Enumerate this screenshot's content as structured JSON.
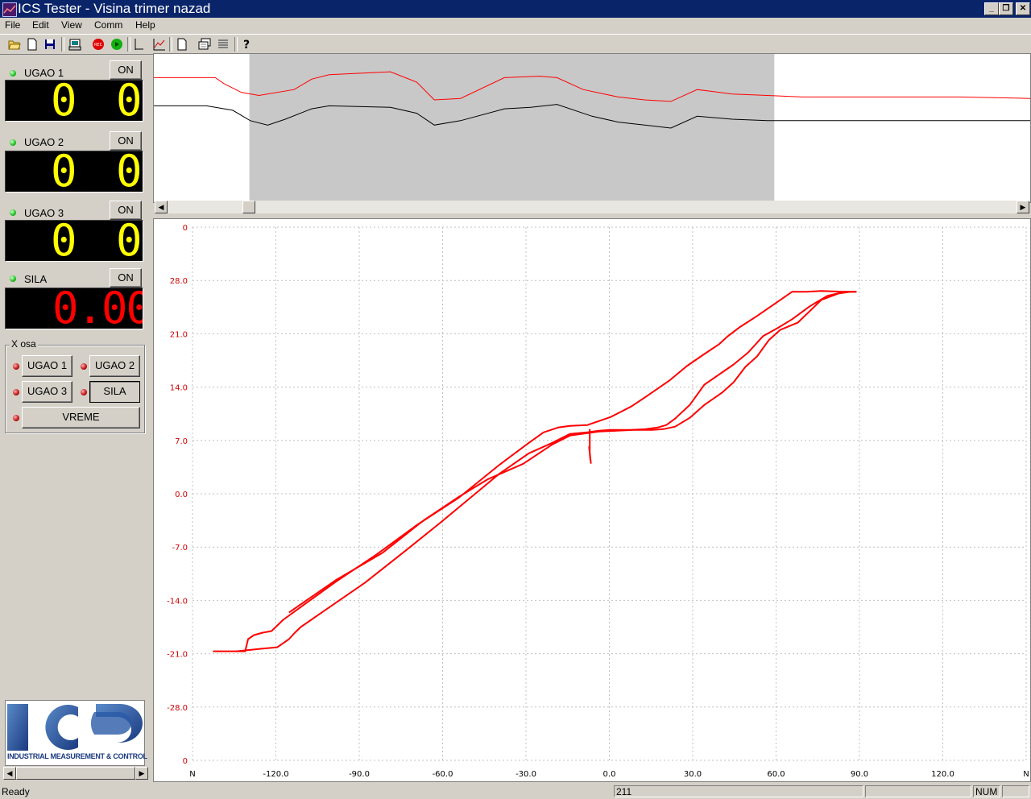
{
  "window": {
    "title": "ICS Tester - Visina trimer nazad"
  },
  "menu": [
    "File",
    "Edit",
    "View",
    "Comm",
    "Help"
  ],
  "toolbar": {
    "icons": [
      "open-icon",
      "new-icon",
      "save-icon",
      "print-icon",
      "record-icon",
      "play-icon",
      "marker-icon",
      "graph-icon",
      "page-icon",
      "display-icon",
      "list-icon",
      "help-icon"
    ],
    "rec_label": "REC"
  },
  "channels": [
    {
      "label": "UGAO 1",
      "button": "ON",
      "display": [
        "0",
        "0"
      ],
      "color": "#ffff00"
    },
    {
      "label": "UGAO 2",
      "button": "ON",
      "display": [
        "0",
        "0"
      ],
      "color": "#ffff00"
    },
    {
      "label": "UGAO 3",
      "button": "ON",
      "display": [
        "0",
        "0"
      ],
      "color": "#ffff00"
    },
    {
      "label": "SILA",
      "button": "ON",
      "display": "0.00",
      "color": "#ff0000"
    }
  ],
  "xaxis_group": {
    "title": "X osa",
    "buttons": [
      "UGAO 1",
      "UGAO 2",
      "UGAO 3",
      "SILA",
      "VREME"
    ],
    "selected": "SILA"
  },
  "logo": {
    "text": "INDUSTRIAL MEASUREMENT & CONTROL"
  },
  "status": {
    "left": "Ready",
    "middle": "211",
    "num": "NUM"
  },
  "chart_data": [
    {
      "type": "line",
      "series": [
        {
          "color": "#ff0000",
          "points": [
            [
              0,
              84
            ],
            [
              7,
              84
            ],
            [
              8,
              80
            ],
            [
              10,
              74
            ],
            [
              12,
              72
            ],
            [
              16,
              76
            ],
            [
              18,
              83
            ],
            [
              20,
              86
            ],
            [
              27,
              88
            ],
            [
              30,
              81
            ],
            [
              32,
              69
            ],
            [
              35,
              70
            ],
            [
              40,
              84
            ],
            [
              44,
              85
            ],
            [
              46,
              84
            ],
            [
              49,
              76
            ],
            [
              53,
              71
            ],
            [
              56,
              69
            ],
            [
              59,
              68
            ],
            [
              62,
              76
            ],
            [
              66,
              73
            ],
            [
              70,
              72
            ],
            [
              74,
              71
            ],
            [
              79,
              71
            ],
            [
              84,
              71
            ],
            [
              88,
              71
            ],
            [
              92,
              71
            ],
            [
              100,
              70
            ]
          ]
        },
        {
          "color": "#000000",
          "points": [
            [
              0,
              65
            ],
            [
              6,
              65
            ],
            [
              9,
              62
            ],
            [
              11,
              55
            ],
            [
              13,
              52
            ],
            [
              15,
              56
            ],
            [
              18,
              63
            ],
            [
              20,
              65
            ],
            [
              27,
              64
            ],
            [
              30,
              60
            ],
            [
              32,
              52
            ],
            [
              35,
              55
            ],
            [
              40,
              63
            ],
            [
              43,
              64
            ],
            [
              46,
              66
            ],
            [
              50,
              58
            ],
            [
              53,
              54
            ],
            [
              56,
              52
            ],
            [
              59,
              50
            ],
            [
              62,
              58
            ],
            [
              66,
              56
            ],
            [
              70,
              55
            ],
            [
              74,
              55
            ],
            [
              79,
              55
            ],
            [
              84,
              55
            ],
            [
              88,
              55
            ],
            [
              92,
              55
            ],
            [
              100,
              55
            ]
          ]
        }
      ],
      "selection": {
        "start": 0.109,
        "end": 0.708
      },
      "scroll_position": 0.09
    },
    {
      "type": "line",
      "x_ticks": [
        "N",
        "-120.0",
        "-90.0",
        "-60.0",
        "-30.0",
        "0.0",
        "30.0",
        "60.0",
        "90.0",
        "120.0",
        "N"
      ],
      "y_ticks": [
        "0",
        "28.0",
        "21.0",
        "14.0",
        "7.0",
        "0.0",
        "-7.0",
        "-14.0",
        "-21.0",
        "-28.0",
        "0"
      ],
      "xlim": [
        -135,
        150
      ],
      "ylim": [
        -33,
        33
      ],
      "grid": true,
      "series": [
        {
          "color": "#ff0000",
          "x": [
            -128,
            -117,
            -116,
            -114,
            -111,
            -108,
            -104,
            -96,
            -86,
            -72,
            -58,
            -44,
            -30,
            -20,
            -15,
            -10,
            -6,
            0,
            8,
            15,
            20,
            28,
            34,
            40,
            45,
            48,
            52,
            58,
            62,
            66,
            70,
            75,
            80,
            88,
            92
          ],
          "y": [
            -19.5,
            -19.5,
            -18,
            -17.5,
            -17.2,
            -17,
            -15.6,
            -13.5,
            -10.9,
            -7.5,
            -3.8,
            -0.5,
            3.6,
            6.3,
            7.6,
            8.2,
            8.4,
            8.5,
            9.5,
            10.8,
            12,
            14,
            15.8,
            17.3,
            18.5,
            19.5,
            20.6,
            22,
            23,
            24,
            25,
            25,
            25.1,
            25,
            25
          ]
        },
        {
          "color": "#ff0000",
          "x": [
            92,
            88,
            82,
            76,
            70,
            65,
            60,
            55,
            50,
            46,
            40,
            35,
            30,
            27,
            24,
            20,
            15,
            8,
            4,
            0,
            -6,
            -12,
            -20,
            -30,
            -40,
            -50,
            -62,
            -76,
            -90,
            -98,
            -100,
            -102,
            -106,
            -112,
            -120
          ],
          "y": [
            25,
            25,
            24.5,
            23.2,
            21.6,
            20.5,
            19.5,
            17.5,
            16,
            15,
            13.5,
            11,
            9.3,
            8.5,
            8.2,
            8,
            7.9,
            7.9,
            7.8,
            7.6,
            7.4,
            6.3,
            5,
            2.5,
            -0.5,
            -3.5,
            -7,
            -11,
            -14.5,
            -16.5,
            -17.2,
            -18,
            -19,
            -19.2,
            -19.5
          ]
        },
        {
          "color": "#ff0000",
          "x": [
            90,
            86,
            80,
            72,
            66,
            62,
            58,
            54,
            50,
            46,
            40,
            35,
            30,
            26,
            22,
            16,
            10,
            4,
            0,
            -6,
            -12,
            -22,
            -34,
            -44,
            -56,
            -70,
            -86,
            -102
          ],
          "y": [
            25,
            24.8,
            24,
            21.2,
            20.3,
            19,
            17,
            15.7,
            13.8,
            12.5,
            11,
            9.4,
            8.3,
            8,
            7.9,
            7.9,
            7.8,
            7.7,
            7.5,
            7.2,
            6.1,
            3.7,
            1.8,
            -0.4,
            -3.3,
            -7.3,
            -10.7,
            -14.7
          ]
        },
        {
          "color": "#ff0000",
          "x": [
            0.8,
            0.8,
            1.2,
            0.6,
            1.0
          ],
          "y": [
            8,
            5,
            3.8,
            5.8,
            4.2
          ]
        }
      ]
    }
  ]
}
